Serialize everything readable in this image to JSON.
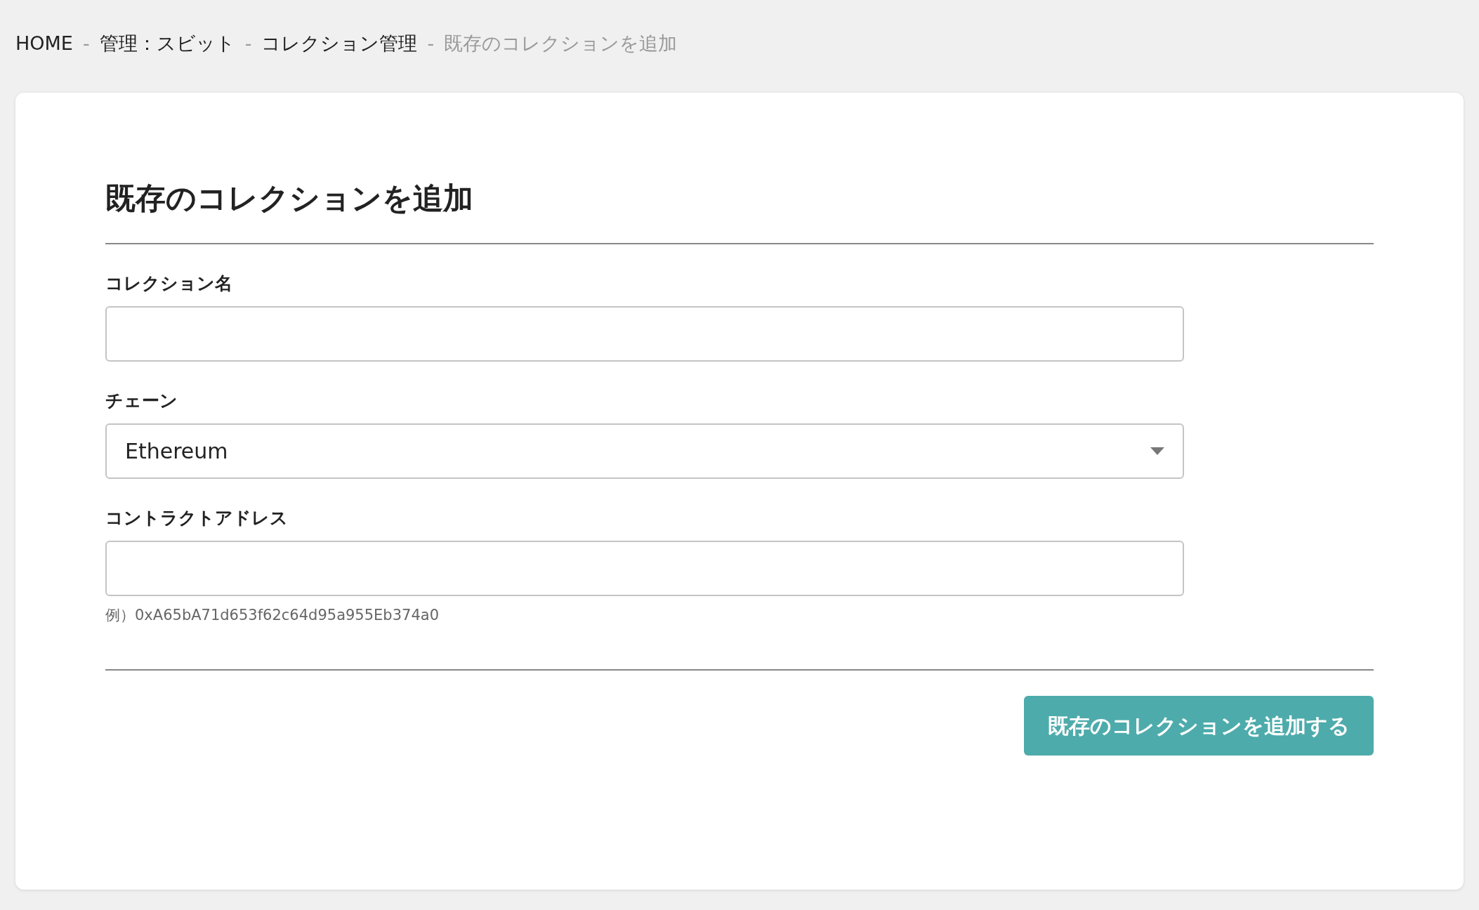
{
  "breadcrumb": [
    {
      "label": "HOME",
      "current": false
    },
    {
      "separator_before": "-",
      "label": "管理：スビット",
      "current": false
    },
    {
      "separator_before": "-",
      "label": "コレクション管理",
      "current": false
    },
    {
      "separator_before": "-",
      "label": "既存のコレクションを追加",
      "current": true
    }
  ],
  "form": {
    "title": "既存のコレクションを追加",
    "fields": [
      {
        "kind": "text",
        "label": "コレクション名"
      },
      {
        "kind": "select",
        "label": "チェーン",
        "value": "Ethereum"
      },
      {
        "kind": "text",
        "label": "コントラクトアドレス",
        "hint": "例）0xA65bA71d653f62c64d95a955Eb374a0"
      }
    ],
    "submit_button": "既存のコレクションを追加する"
  }
}
